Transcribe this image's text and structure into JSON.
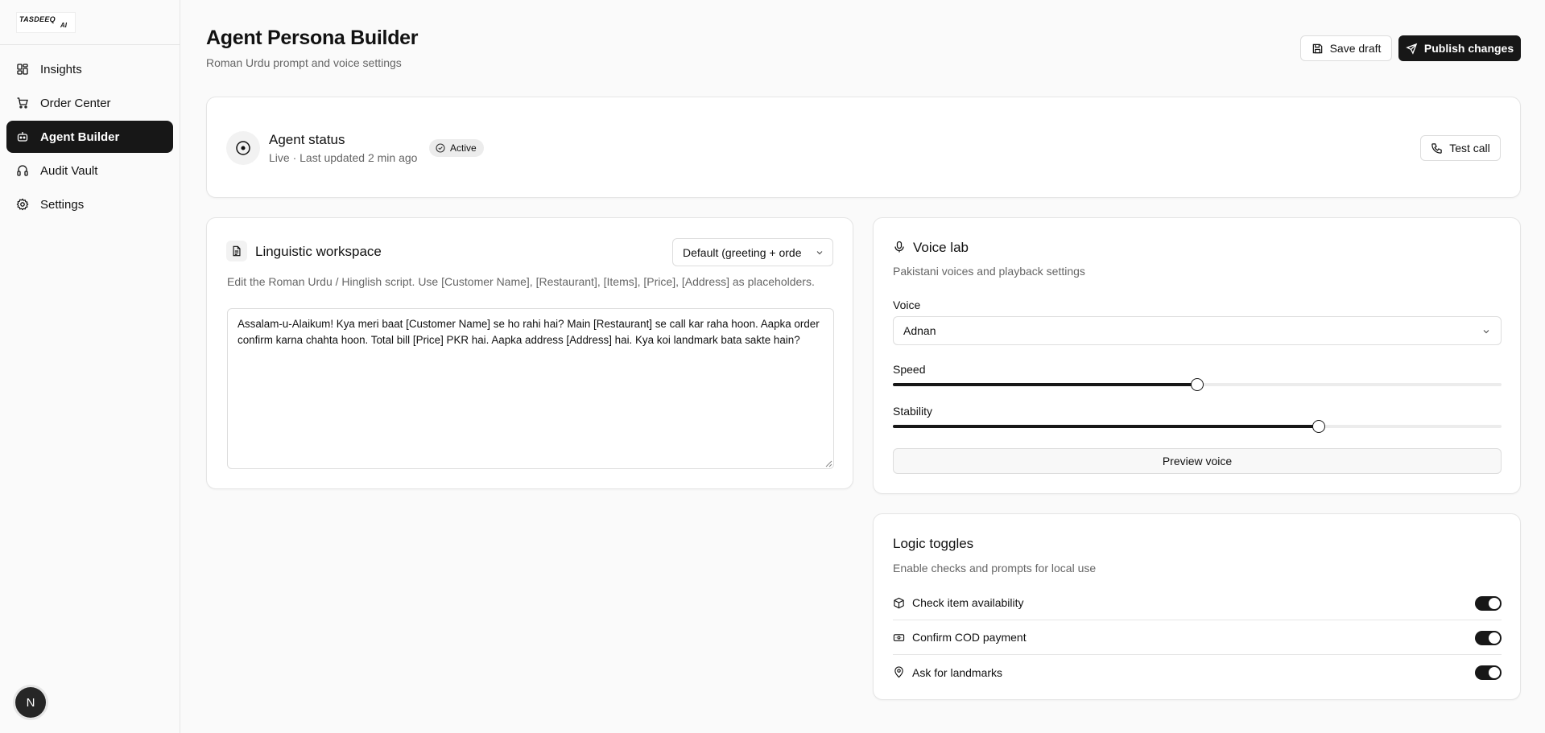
{
  "sidebar": {
    "logo": {
      "line1": "TASDEEQ",
      "line2": "AI"
    },
    "items": [
      {
        "label": "Insights",
        "icon": "grid-icon"
      },
      {
        "label": "Order Center",
        "icon": "cart-icon"
      },
      {
        "label": "Agent Builder",
        "icon": "bot-icon",
        "active": true
      },
      {
        "label": "Audit Vault",
        "icon": "vault-icon"
      },
      {
        "label": "Settings",
        "icon": "gear-icon"
      }
    ],
    "avatar_initial": "N"
  },
  "header": {
    "title": "Agent Persona Builder",
    "subtitle": "Roman Urdu prompt and voice settings",
    "save_label": "Save draft",
    "publish_label": "Publish changes"
  },
  "status": {
    "title": "Agent status",
    "subtitle": "Live · Last updated 2 min ago",
    "badge": "Active",
    "test_call_label": "Test call"
  },
  "linguistic": {
    "title": "Linguistic workspace",
    "template_selected": "Default (greeting + orde",
    "help": "Edit the Roman Urdu / Hinglish script. Use [Customer Name], [Restaurant], [Items], [Price], [Address] as placeholders.",
    "script": "Assalam-u-Alaikum! Kya meri baat [Customer Name] se ho rahi hai? Main [Restaurant] se call kar raha hoon. Aapka order confirm karna chahta hoon. Total bill [Price] PKR hai. Aapka address [Address] hai. Kya koi landmark bata sakte hain?"
  },
  "voice_lab": {
    "title": "Voice lab",
    "subtitle": "Pakistani voices and playback settings",
    "voice_label": "Voice",
    "voice_value": "Adnan",
    "speed_label": "Speed",
    "speed_value": 0.5,
    "stability_label": "Stability",
    "stability_value": 0.7,
    "preview_label": "Preview voice"
  },
  "logic": {
    "title": "Logic toggles",
    "subtitle": "Enable checks and prompts for local use",
    "toggles": [
      {
        "label": "Check item availability",
        "icon": "box-icon",
        "on": true
      },
      {
        "label": "Confirm COD payment",
        "icon": "cash-icon",
        "on": true
      },
      {
        "label": "Ask for landmarks",
        "icon": "map-pin-icon",
        "on": true
      }
    ]
  },
  "colors": {
    "accent": "#171717",
    "muted_text": "#666666",
    "border": "#e5e5e5"
  }
}
